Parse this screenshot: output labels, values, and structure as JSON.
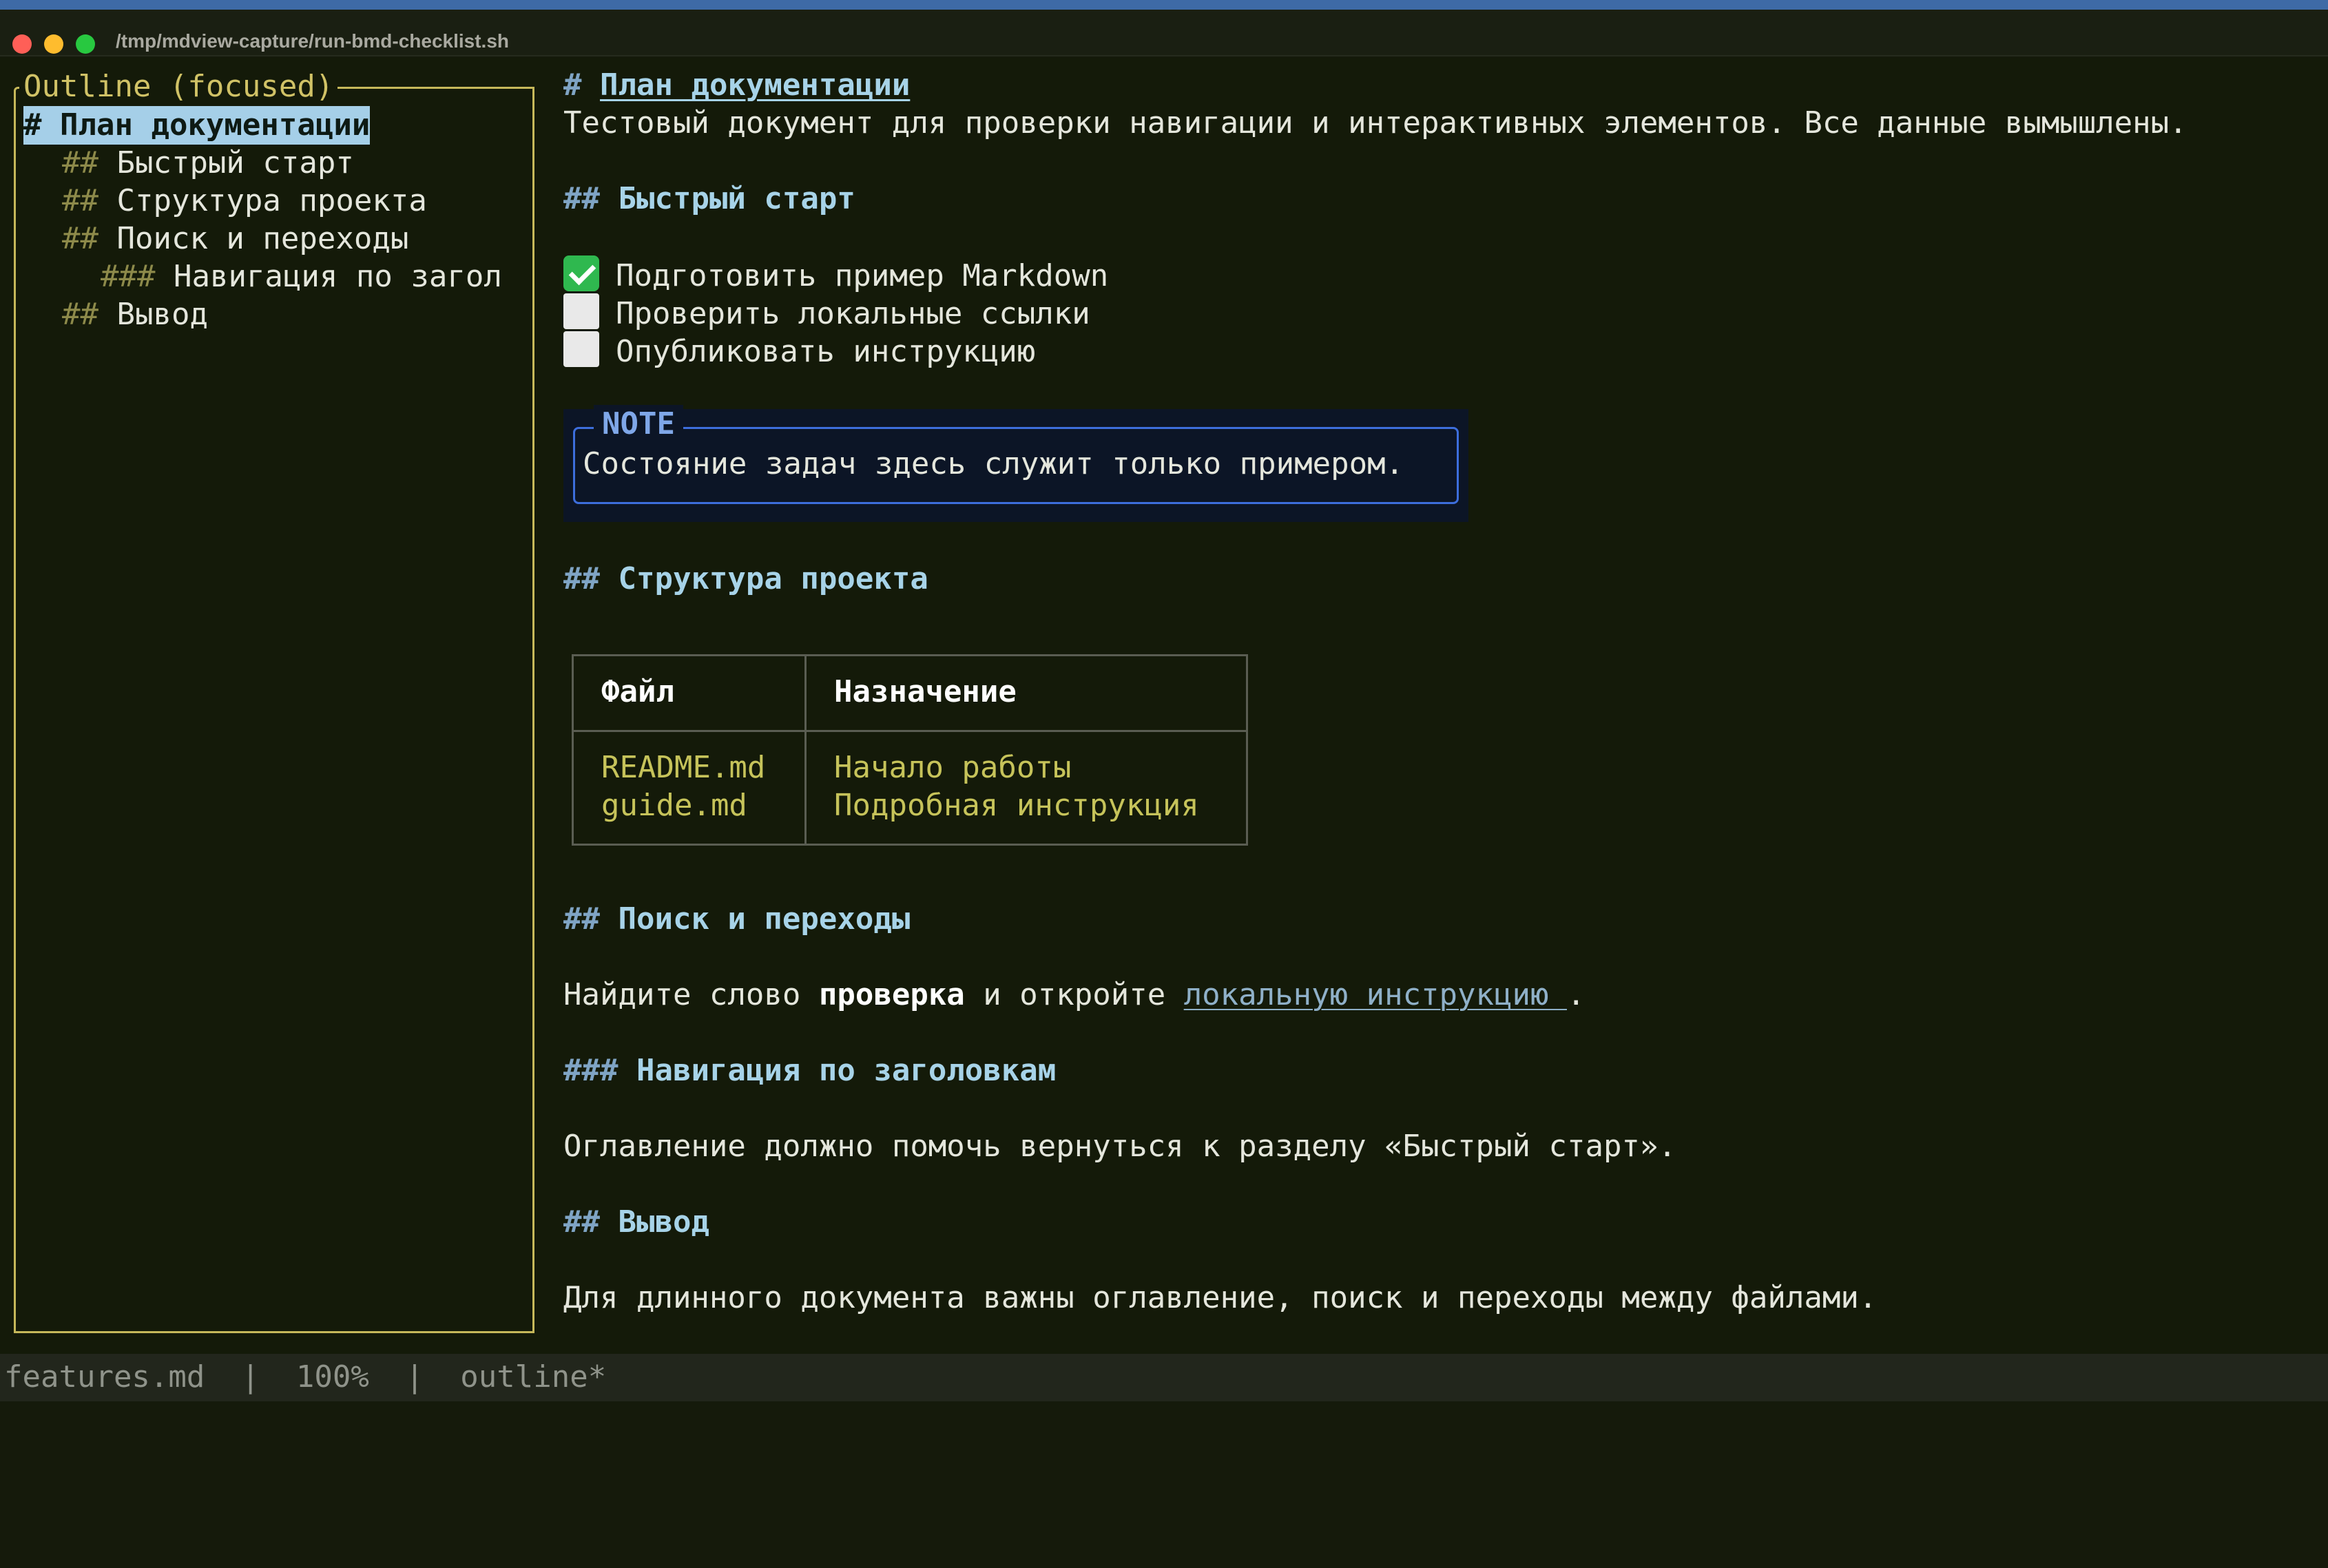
{
  "window": {
    "title": "/tmp/mdview-capture/run-bmd-checklist.sh"
  },
  "outline": {
    "title": "Outline (focused)",
    "items": [
      {
        "hash": "#",
        "label": "План документации",
        "selected": true
      },
      {
        "hash": "##",
        "label": "Быстрый старт"
      },
      {
        "hash": "##",
        "label": "Структура проекта"
      },
      {
        "hash": "##",
        "label": "Поиск и переходы"
      },
      {
        "hash": "###",
        "label": "Навигация по загол"
      },
      {
        "hash": "##",
        "label": "Вывод"
      }
    ]
  },
  "doc": {
    "h1": {
      "hash": "#",
      "text": "План документации"
    },
    "intro": "Тестовый документ для проверки навигации и интерактивных элементов. Все данные вымышлены.",
    "quickstart": {
      "hash": "##",
      "text": "Быстрый старт"
    },
    "tasks": [
      {
        "text": "Подготовить пример Markdown",
        "done": true
      },
      {
        "text": "Проверить локальные ссылки",
        "done": false
      },
      {
        "text": "Опубликовать инструкцию",
        "done": false
      }
    ],
    "note": {
      "label": "NOTE",
      "text": "Состояние задач здесь служит только примером."
    },
    "structure": {
      "hash": "##",
      "text": "Структура проекта"
    },
    "table": {
      "headers": [
        "Файл",
        "Назначение"
      ],
      "rows": [
        [
          "README.md",
          "Начало работы"
        ],
        [
          "guide.md",
          "Подробная инструкция"
        ]
      ]
    },
    "search": {
      "hash": "##",
      "text": "Поиск и переходы"
    },
    "search_para": {
      "before": "Найдите слово ",
      "bold": "проверка",
      "middle": " и откройте ",
      "link": "локальную инструкцию ",
      "after": "."
    },
    "nav": {
      "hash": "###",
      "text": "Навигация по заголовкам"
    },
    "nav_para": "Оглавление должно помочь вернуться к разделу «Быстрый старт».",
    "conclusion": {
      "hash": "##",
      "text": "Вывод"
    },
    "conclusion_para": "Для длинного документа важны оглавление, поиск и переходы между файлами."
  },
  "statusbar": {
    "text": "features.md  |  100%  |  outline*"
  },
  "colors": {
    "background": "#141a09",
    "outline_border": "#c6b85a",
    "heading": "#a7d3e8",
    "note_border": "#3d6edc",
    "table_data": "#c6c35a",
    "check_done": "#2fb84f"
  }
}
